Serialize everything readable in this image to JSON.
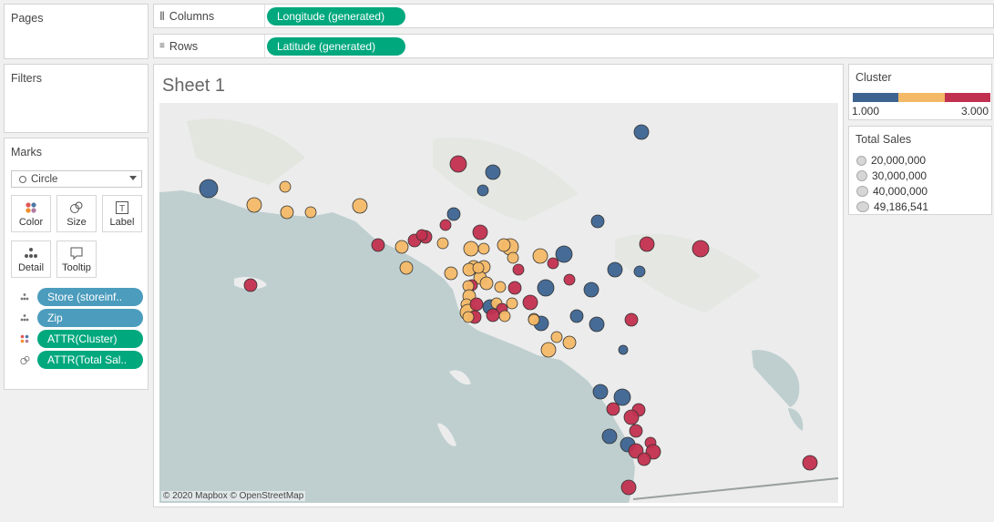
{
  "panes": {
    "pages_title": "Pages",
    "filters_title": "Filters",
    "marks_title": "Marks"
  },
  "shelves": {
    "columns_label": "Columns",
    "columns_pill": "Longitude (generated)",
    "rows_label": "Rows",
    "rows_pill": "Latitude (generated)"
  },
  "marks": {
    "type": "Circle",
    "buttons": {
      "color": "Color",
      "size": "Size",
      "label": "Label",
      "detail": "Detail",
      "tooltip": "Tooltip"
    },
    "fields": [
      {
        "label": "Store (storeinf..",
        "kind": "detail",
        "color": "#4b9cbd"
      },
      {
        "label": "Zip",
        "kind": "detail",
        "color": "#4b9cbd"
      },
      {
        "label": "ATTR(Cluster)",
        "kind": "color",
        "color": "#00a87e"
      },
      {
        "label": "ATTR(Total Sal..",
        "kind": "size",
        "color": "#00a87e"
      }
    ]
  },
  "sheet": {
    "title": "Sheet 1",
    "attribution": "© 2020 Mapbox © OpenStreetMap"
  },
  "cluster_legend": {
    "title": "Cluster",
    "min": "1.000",
    "max": "3.000",
    "colors": [
      "#3d6491",
      "#f4b967",
      "#c2304f"
    ]
  },
  "sales_legend": {
    "title": "Total Sales",
    "items": [
      "20,000,000",
      "30,000,000",
      "40,000,000",
      "49,186,541"
    ]
  },
  "map_colors": {
    "land": "#ececec",
    "water": "#bfcfcf",
    "cluster1": "#3d6491",
    "cluster2": "#f4b967",
    "cluster3": "#c2304f"
  }
}
